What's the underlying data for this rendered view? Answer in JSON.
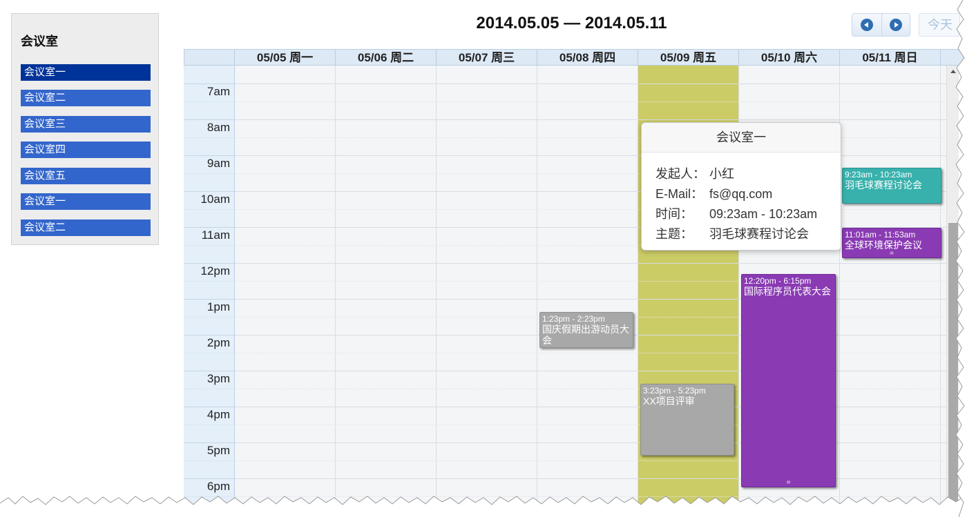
{
  "sidebar": {
    "title": "会议室",
    "rooms": [
      {
        "label": "会议室一",
        "selected": true
      },
      {
        "label": "会议室二",
        "selected": false
      },
      {
        "label": "会议室三",
        "selected": false
      },
      {
        "label": "会议室四",
        "selected": false
      },
      {
        "label": "会议室五",
        "selected": false
      },
      {
        "label": "会议室一",
        "selected": false
      },
      {
        "label": "会议室二",
        "selected": false
      }
    ]
  },
  "header": {
    "title": "2014.05.05 — 2014.05.11",
    "prev_icon": "chevron-left-icon",
    "next_icon": "chevron-right-icon",
    "today_label": "今天"
  },
  "calendar": {
    "days": [
      "05/05 周一",
      "05/06 周二",
      "05/07 周三",
      "05/08 周四",
      "05/09 周五",
      "05/10 周六",
      "05/11 周日"
    ],
    "highlighted_day": "05/09 周五",
    "highlight_color": "#cccc66",
    "times": [
      "7am",
      "8am",
      "9am",
      "10am",
      "11am",
      "12pm",
      "1pm",
      "2pm",
      "3pm",
      "4pm",
      "5pm",
      "6pm"
    ],
    "events": [
      {
        "day": "05/08 周四",
        "start": "1:23pm",
        "end": "2:23pm",
        "time": "1:23pm - 2:23pm",
        "title": "国庆假期出游动员大会",
        "color": "#a8a8a8"
      },
      {
        "day": "05/09 周五",
        "start": "3:23pm",
        "end": "5:23pm",
        "time": "3:23pm - 5:23pm",
        "title": "XX项目评审",
        "color": "#a8a8a8"
      },
      {
        "day": "05/10 周六",
        "start": "12:20pm",
        "end": "6:15pm",
        "time": "12:20pm - 6:15pm",
        "title": "国际程序员代表大会",
        "color": "#8a3ab3",
        "handle": "="
      },
      {
        "day": "05/11 周日",
        "start": "9:23am",
        "end": "10:23am",
        "time": "9:23am - 10:23am",
        "title": "羽毛球赛程讨论会",
        "color": "#38b1ad"
      },
      {
        "day": "05/11 周日",
        "start": "11:01am",
        "end": "11:53am",
        "time": "11:01am - 11:53am",
        "title": "全球环境保护会议",
        "color": "#8a3ab3",
        "handle": "="
      }
    ]
  },
  "popover": {
    "title": "会议室一",
    "rows": [
      {
        "label": "发起人：",
        "value": "小红"
      },
      {
        "label": "E-Mail：",
        "value": "fs@qq.com"
      },
      {
        "label": "时间：",
        "value": "09:23am - 10:23am"
      },
      {
        "label": "主题：",
        "value": "羽毛球赛程讨论会"
      }
    ]
  }
}
